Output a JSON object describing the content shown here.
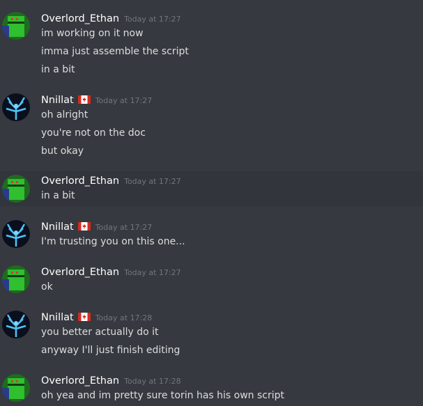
{
  "colors": {
    "background": "#36393f",
    "highlight_row": "#32353b",
    "username": "#ffffff",
    "message_text": "#dcddde",
    "timestamp": "#72767d"
  },
  "messages": [
    {
      "author": "Overlord_Ethan",
      "avatar_icon": "green-robot-avatar-icon",
      "timestamp": "Today at 17:27",
      "lines": [
        "im working on it now",
        "imma just assemble the script",
        "in a bit"
      ]
    },
    {
      "author": "Nnillat",
      "flag_icon": "canada-flag-icon",
      "avatar_icon": "blue-tree-avatar-icon",
      "timestamp": "Today at 17:27",
      "lines": [
        "oh alright",
        "you're not on the doc",
        "but okay"
      ]
    },
    {
      "author": "Overlord_Ethan",
      "avatar_icon": "green-robot-avatar-icon",
      "timestamp": "Today at 17:27",
      "lines": [
        "in a bit"
      ]
    },
    {
      "author": "Nnillat",
      "flag_icon": "canada-flag-icon",
      "avatar_icon": "blue-tree-avatar-icon",
      "timestamp": "Today at 17:27",
      "lines": [
        "I'm trusting you on this one..."
      ]
    },
    {
      "author": "Overlord_Ethan",
      "avatar_icon": "green-robot-avatar-icon",
      "timestamp": "Today at 17:27",
      "lines": [
        "ok"
      ]
    },
    {
      "author": "Nnillat",
      "flag_icon": "canada-flag-icon",
      "avatar_icon": "blue-tree-avatar-icon",
      "timestamp": "Today at 17:28",
      "lines": [
        "you better actually do it",
        "anyway I'll just finish editing"
      ]
    },
    {
      "author": "Overlord_Ethan",
      "avatar_icon": "green-robot-avatar-icon",
      "timestamp": "Today at 17:28",
      "lines": [
        "oh yea and im pretty sure torin has his own script"
      ]
    }
  ]
}
